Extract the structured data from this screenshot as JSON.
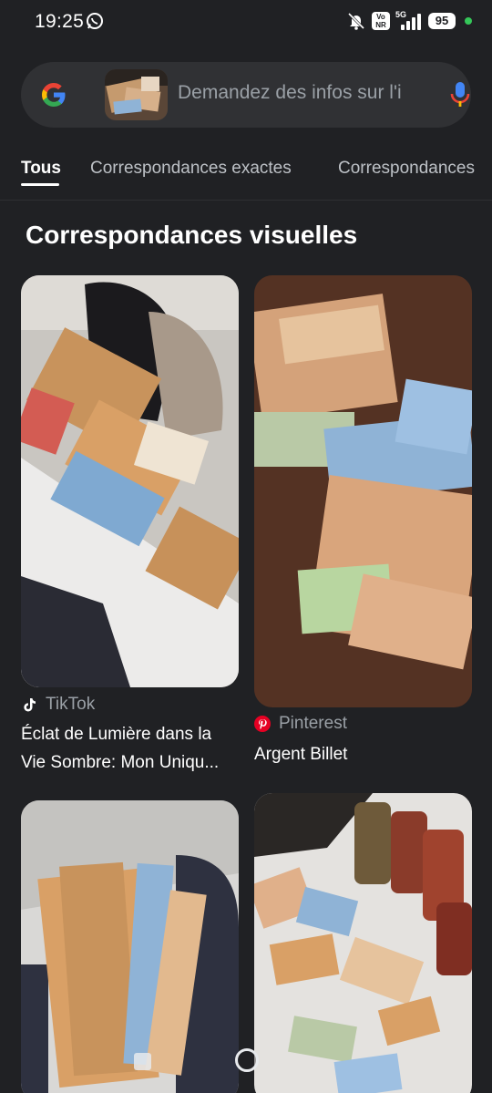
{
  "status_bar": {
    "time": "19:25",
    "network_type": "5G",
    "volte_label": "Vo NR",
    "battery_level": "95",
    "icons": [
      "whatsapp-icon",
      "bell-off-icon",
      "volte-icon",
      "signal-icon",
      "battery-icon"
    ]
  },
  "search": {
    "placeholder": "Demandez des infos sur l'i",
    "logo": "google-logo",
    "mic": "mic-icon"
  },
  "tabs": [
    {
      "label": "Tous",
      "active": true
    },
    {
      "label": "Correspondances exactes",
      "active": false
    },
    {
      "label": "Correspondances",
      "active": false
    }
  ],
  "section_title": "Correspondances visuelles",
  "results": [
    {
      "source": "TikTok",
      "title_line1": "Éclat de Lumière dans la",
      "title_line2": "Vie Sombre: Mon Uniqu..."
    },
    {
      "source": "Pinterest",
      "title_line1": "Argent Billet"
    },
    {
      "source": ""
    },
    {
      "source": ""
    }
  ],
  "colors": {
    "background": "#202124",
    "search_bar": "#303134",
    "tiktok": "#ffffff",
    "pinterest": "#e60023",
    "camera_indicator": "#35c759"
  }
}
